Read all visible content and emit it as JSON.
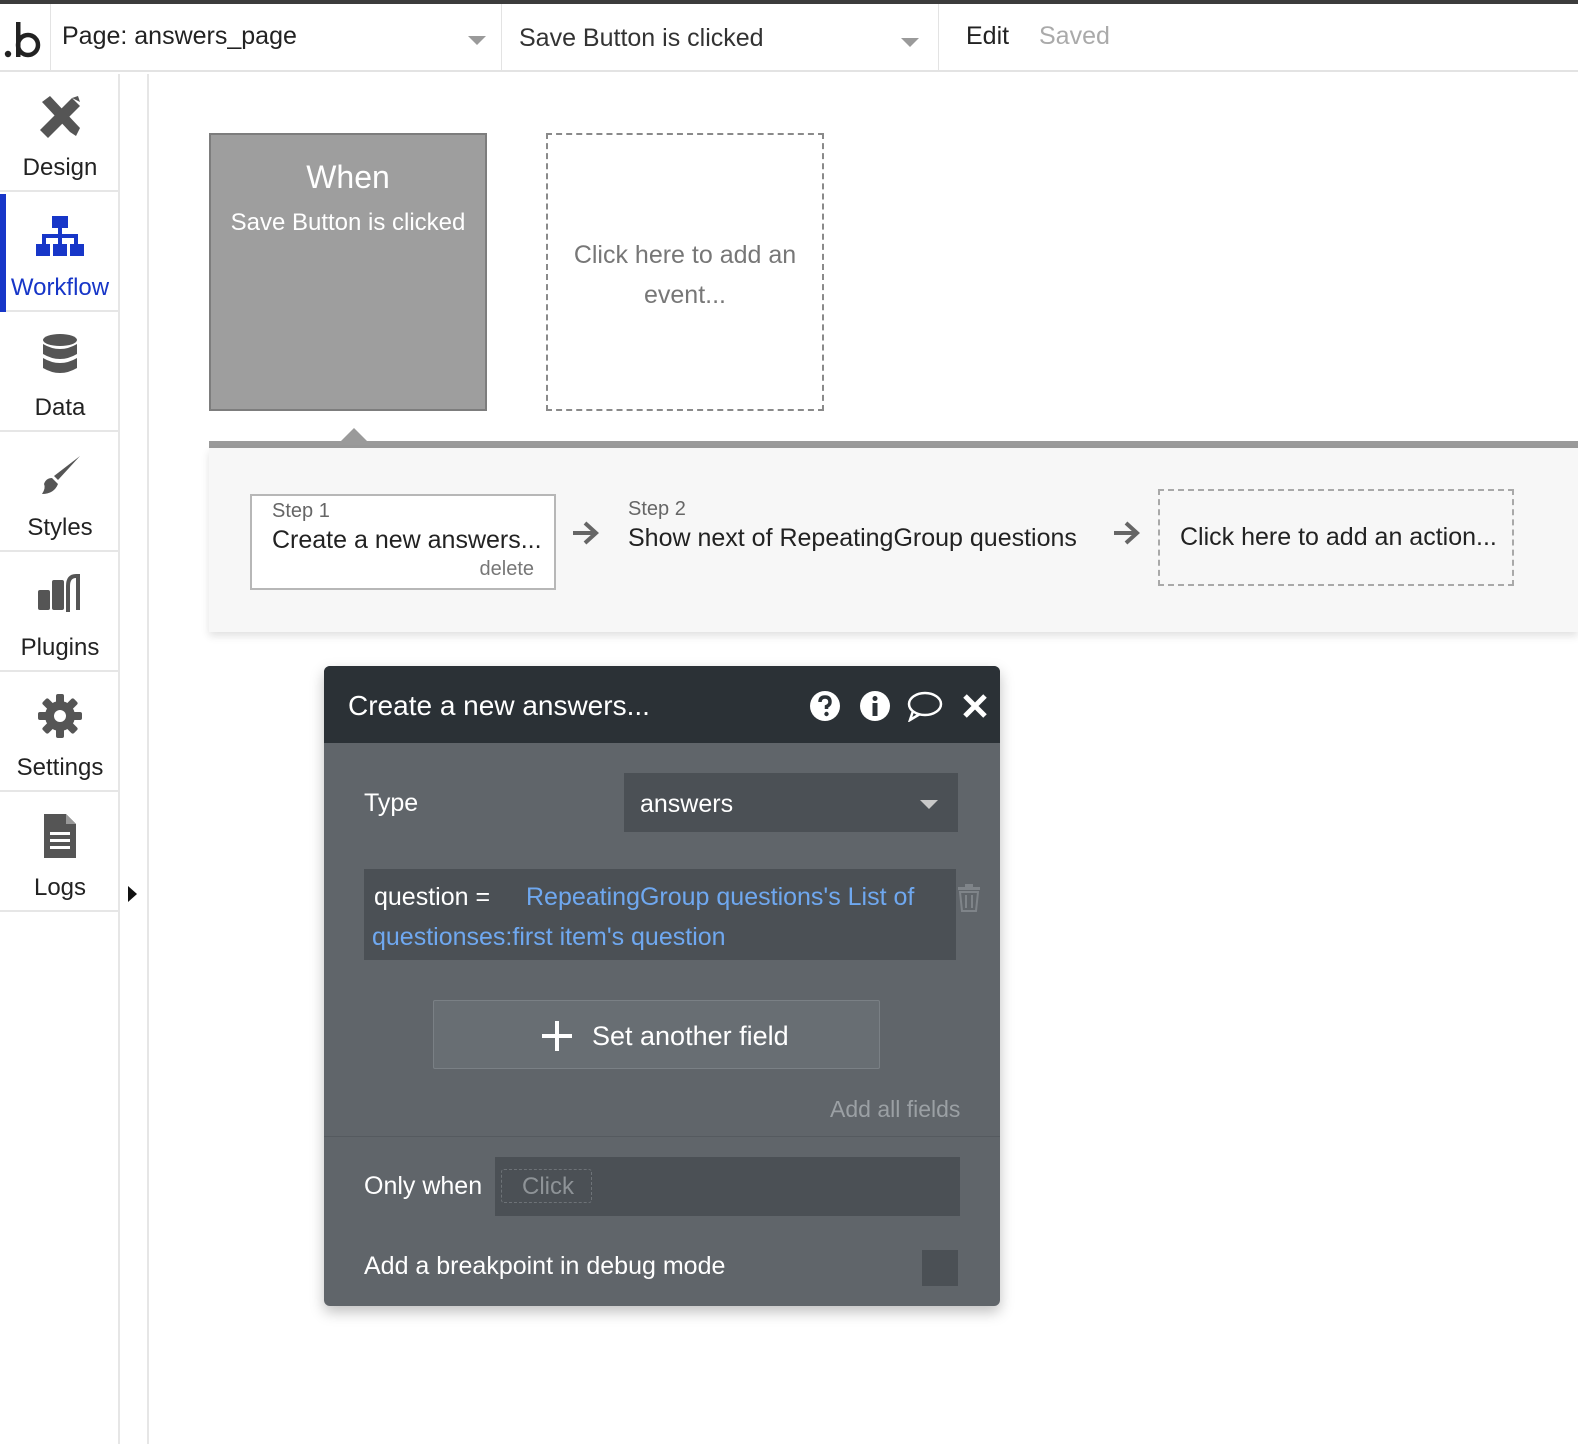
{
  "topbar": {
    "logo_text": ".b",
    "page_select": "Page: answers_page",
    "event_select": "Save Button is clicked",
    "edit_label": "Edit",
    "saved_label": "Saved"
  },
  "sidebar": {
    "items": [
      {
        "label": "Design",
        "icon": "design-icon"
      },
      {
        "label": "Workflow",
        "icon": "workflow-icon",
        "active": true
      },
      {
        "label": "Data",
        "icon": "database-icon"
      },
      {
        "label": "Styles",
        "icon": "brush-icon"
      },
      {
        "label": "Plugins",
        "icon": "plugin-icon"
      },
      {
        "label": "Settings",
        "icon": "gear-icon"
      },
      {
        "label": "Logs",
        "icon": "document-icon"
      }
    ]
  },
  "events": {
    "when_title": "When",
    "when_sub": "Save Button is clicked",
    "add_event": "Click here to add an event..."
  },
  "steps": {
    "step1_num": "Step 1",
    "step1_title": "Create a new answers...",
    "step1_delete": "delete",
    "step2_num": "Step 2",
    "step2_title": "Show next of RepeatingGroup questions",
    "add_action": "Click here to add an action..."
  },
  "dialog": {
    "title": "Create a new answers...",
    "type_label": "Type",
    "type_value": "answers",
    "field_key": "question  =",
    "field_value_line1": "RepeatingGroup questions's List of",
    "field_value_line2": "questionses:first item's question",
    "set_another": "Set another field",
    "add_all": "Add all fields",
    "only_when_label": "Only when",
    "only_when_placeholder": "Click",
    "breakpoint_label": "Add a breakpoint in debug mode",
    "breakpoint_checked": false
  },
  "colors": {
    "accent": "#1736c8",
    "dialog_bg": "#60656a",
    "dialog_header": "#2b3136",
    "expression_blue": "#6fa8f0",
    "when_card": "#9e9e9e"
  }
}
